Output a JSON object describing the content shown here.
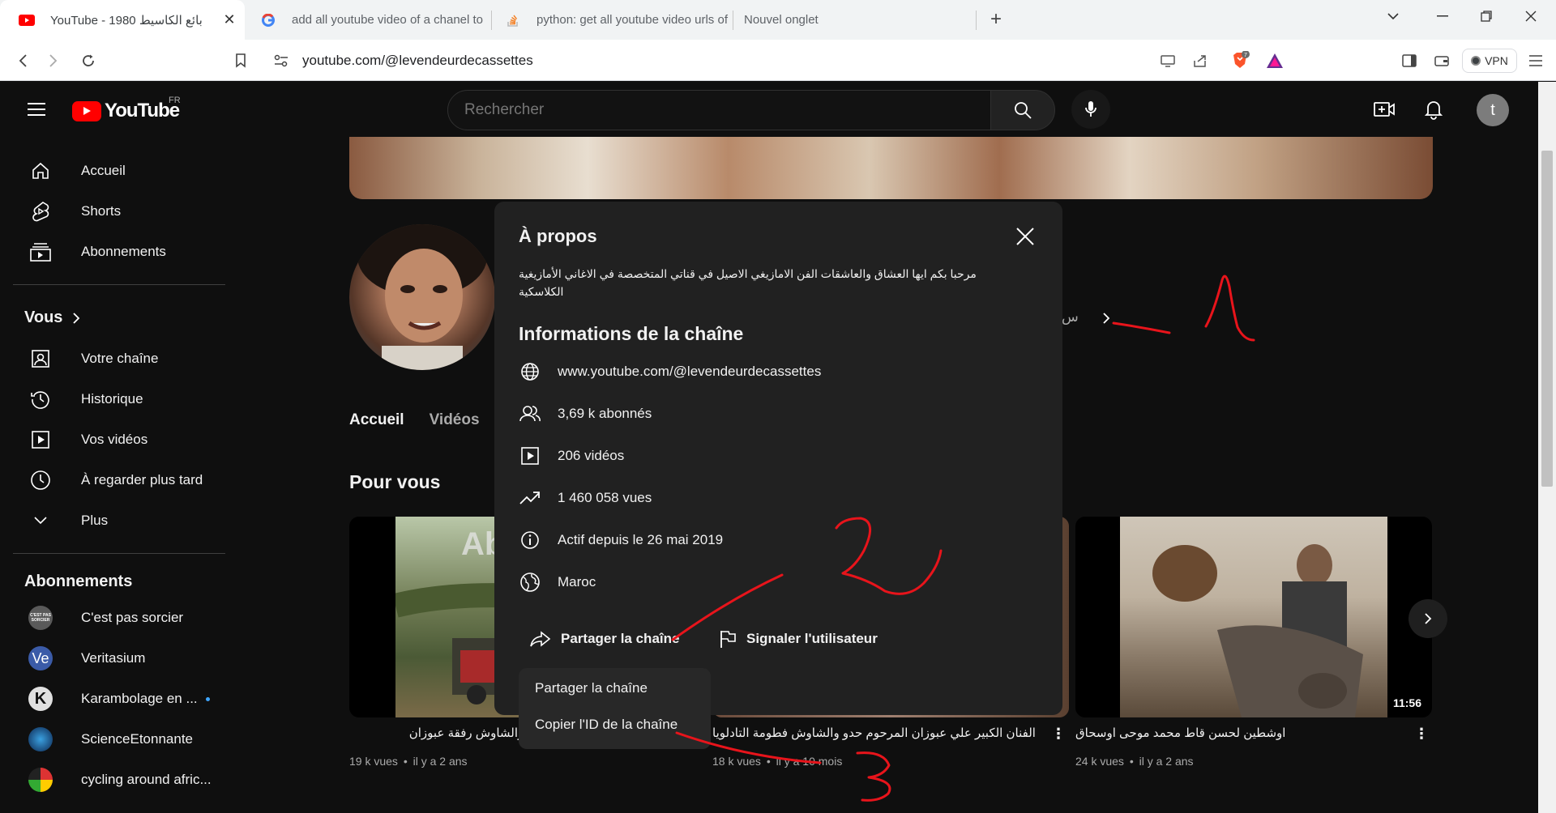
{
  "browser": {
    "tabs": [
      {
        "title": "YouTube - 1980 بائع الكاسيط",
        "active": true,
        "favicon": "youtube-icon"
      },
      {
        "title": "add all youtube video of a chanel to",
        "active": false,
        "favicon": "google-icon"
      },
      {
        "title": "python: get all youtube video urls of",
        "active": false,
        "favicon": "stackoverflow-icon"
      },
      {
        "title": "Nouvel onglet",
        "active": false,
        "favicon": ""
      }
    ],
    "new_tab_label": "+",
    "address": "youtube.com/@levendeurdecassettes",
    "vpn_label": "VPN",
    "brave_badge": "7"
  },
  "youtube": {
    "logo_text": "YouTube",
    "region": "FR",
    "search_placeholder": "Rechercher",
    "avatar_letter": "t"
  },
  "sidebar": {
    "main": [
      {
        "label": "Accueil",
        "icon": "home-icon"
      },
      {
        "label": "Shorts",
        "icon": "shorts-icon"
      },
      {
        "label": "Abonnements",
        "icon": "subscriptions-icon"
      }
    ],
    "you_label": "Vous",
    "you_items": [
      {
        "label": "Votre chaîne",
        "icon": "your-channel-icon"
      },
      {
        "label": "Historique",
        "icon": "history-icon"
      },
      {
        "label": "Vos vidéos",
        "icon": "your-videos-icon"
      },
      {
        "label": "À regarder plus tard",
        "icon": "watch-later-icon"
      },
      {
        "label": "Plus",
        "icon": "chevron-down-icon"
      }
    ],
    "subscriptions_label": "Abonnements",
    "subscriptions": [
      {
        "label": "C'est pas sorcier",
        "avatar_color": "#5a5a5a",
        "avatar_text": "C'EST PAS SORCIER"
      },
      {
        "label": "Veritasium",
        "avatar_color": "#3b5ba8",
        "avatar_text": "Ve"
      },
      {
        "label": "Karambolage en ...",
        "avatar_color": "#e0e0e0",
        "avatar_text": "K"
      },
      {
        "label": "ScienceEtonnante",
        "avatar_color": "#1a4a7a",
        "avatar_text": ""
      },
      {
        "label": "cycling around afric...",
        "avatar_color": "#2a2a2a",
        "avatar_text": ""
      }
    ]
  },
  "channel": {
    "tabs": [
      "Accueil",
      "Vidéos"
    ],
    "header_more_text": "س",
    "section_title": "Pour vous",
    "videos": [
      {
        "title": "المرحوم حدو والشاوش رفقة عبوزان",
        "views": "19 k vues",
        "age": "il y a 2 ans",
        "duration": "",
        "thumb_text": "Ab"
      },
      {
        "title": "الفنان الكبير علي عبوزان المرحوم حدو والشاوش فطومة التادلويا",
        "views": "18 k vues",
        "age": "il y a 10 mois",
        "duration": ""
      },
      {
        "title": "اوشطين لحسن قاط محمد موحى اوسحاق",
        "views": "24 k vues",
        "age": "il y a 2 ans",
        "duration": "11:56"
      }
    ],
    "meta_separator": "•"
  },
  "about": {
    "title": "À propos",
    "description": "مرحبا بكم ايها العشاق والعاشقات الفن الامازيغي الاصيل في قناتي المتخصصة في الاغاني الأمازيغية الكلاسكية",
    "info_title": "Informations de la chaîne",
    "rows": [
      {
        "icon": "globe-icon",
        "text": "www.youtube.com/@levendeurdecassettes"
      },
      {
        "icon": "subscribers-icon",
        "text": "3,69 k abonnés"
      },
      {
        "icon": "videos-icon",
        "text": "206 vidéos"
      },
      {
        "icon": "trending-icon",
        "text": "1 460 058 vues"
      },
      {
        "icon": "info-icon",
        "text": "Actif depuis le 26 mai 2019"
      },
      {
        "icon": "location-globe-icon",
        "text": "Maroc"
      }
    ],
    "share_label": "Partager la chaîne",
    "report_label": "Signaler l'utilisateur"
  },
  "share_menu": {
    "items": [
      "Partager la chaîne",
      "Copier l'ID de la chaîne"
    ]
  },
  "annotations": {
    "color": "#e8141b",
    "labels": [
      "1",
      "2",
      "3"
    ]
  }
}
